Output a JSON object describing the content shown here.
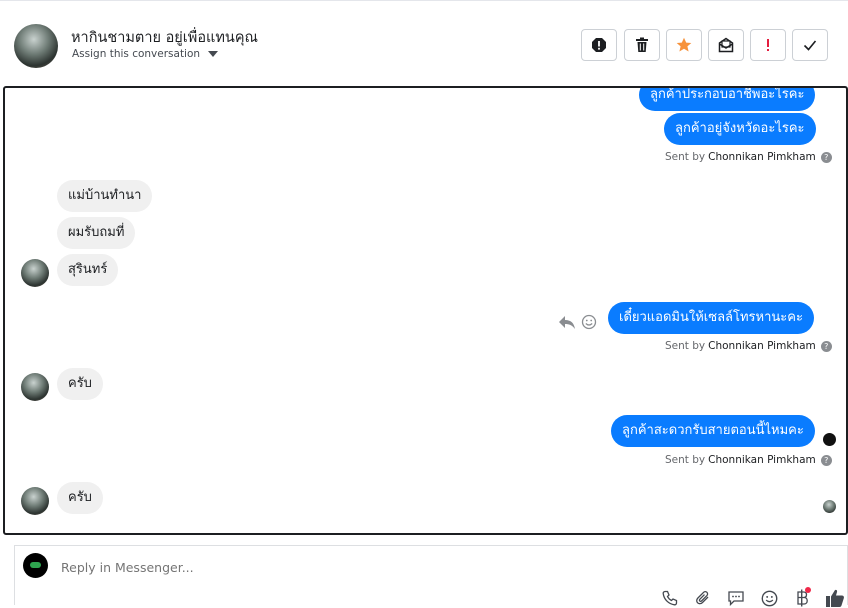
{
  "header": {
    "contact_name": "หากินชามตาย อยู่เพื่อแทนคุณ",
    "assign_label": "Assign this conversation",
    "actions": [
      "spam-icon",
      "trash-icon",
      "star-icon",
      "mark-unread-icon",
      "important-icon",
      "done-icon"
    ],
    "colors": {
      "star": "#f7923a",
      "important": "#e41e3f"
    }
  },
  "messages": {
    "out1": "ลูกค้าประกอบอาชีพอะไรคะ",
    "out2": "ลูกค้าอยู่จังหวัดอะไรคะ",
    "in1": "แม่บ้านทำนา",
    "in2": "ผมรับถมที่",
    "in3": "สุรินทร์",
    "out3": "เดี๋ยวแอดมินให้เซลล์โทรหานะคะ",
    "in4": "ครับ",
    "out4": "ลูกค้าสะดวกรับสายตอนนี้ไหมคะ",
    "in5": "ครับ"
  },
  "sent_by": {
    "prefix": "Sent by",
    "name": "Chonnikan Pimkham",
    "help": "?"
  },
  "composer": {
    "placeholder": "Reply in Messenger...",
    "tools": [
      "phone-icon",
      "attachment-icon",
      "saved-reply-icon",
      "emoji-icon",
      "baht-icon",
      "like-icon"
    ]
  },
  "colors": {
    "outgoing": "#0a7cff",
    "incoming": "#f0f0f0"
  }
}
